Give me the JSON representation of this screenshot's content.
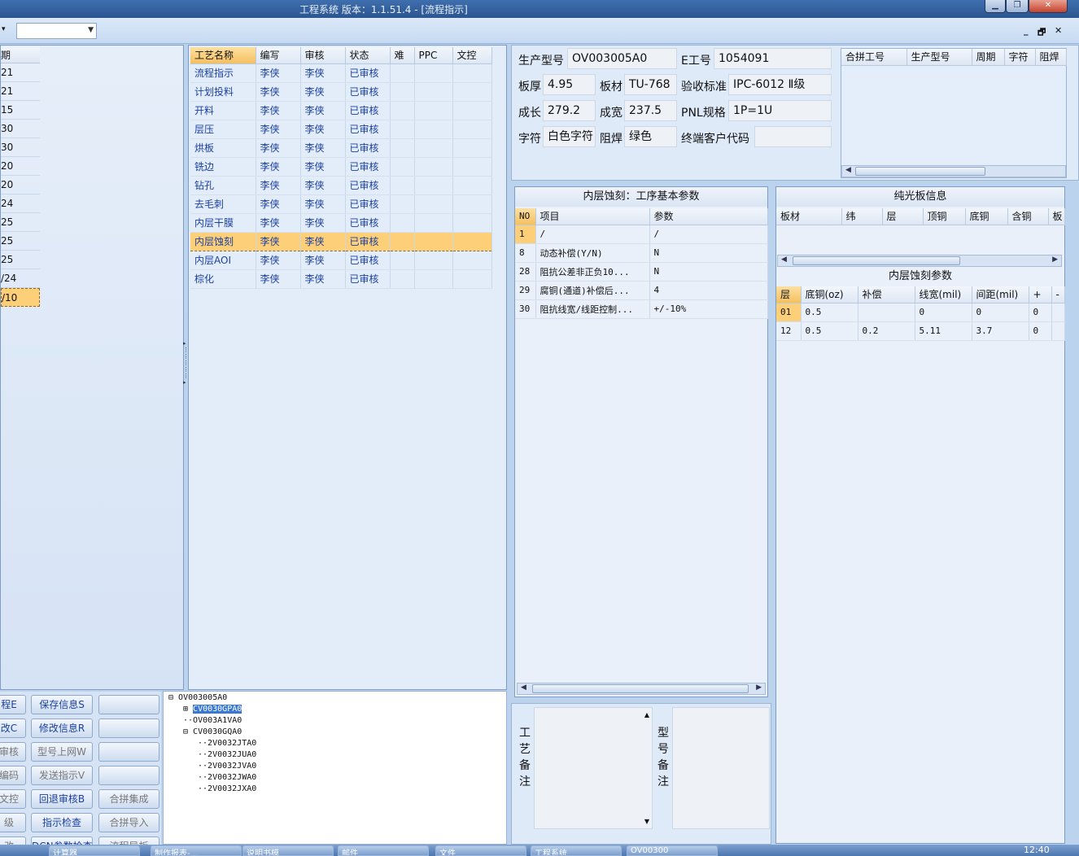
{
  "window": {
    "title": "工程系统    版本：1.1.51.4 - [流程指示]",
    "min": "▁",
    "restore": "❐",
    "close": "✕"
  },
  "toolbar": {
    "combo_value": "",
    "mdi_min": "_",
    "mdi_restore": "🗗",
    "mdi_close": "✕"
  },
  "left_list": {
    "header": "期",
    "items": [
      "21",
      "21",
      "15",
      "30",
      "30",
      "20",
      "20",
      "24",
      "25",
      "25",
      "25",
      "/24",
      "/10"
    ],
    "selected_index": 12
  },
  "process_grid": {
    "columns": [
      "工艺名称",
      "编写",
      "审核",
      "状态",
      "难",
      "PPC",
      "文控"
    ],
    "rows": [
      [
        "流程指示",
        "李侠",
        "李侠",
        "已审核"
      ],
      [
        "计划投料",
        "李侠",
        "李侠",
        "已审核"
      ],
      [
        "开料",
        "李侠",
        "李侠",
        "已审核"
      ],
      [
        "层压",
        "李侠",
        "李侠",
        "已审核"
      ],
      [
        "烘板",
        "李侠",
        "李侠",
        "已审核"
      ],
      [
        "铣边",
        "李侠",
        "李侠",
        "已审核"
      ],
      [
        "钻孔",
        "李侠",
        "李侠",
        "已审核"
      ],
      [
        "去毛刺",
        "李侠",
        "李侠",
        "已审核"
      ],
      [
        "内层干膜",
        "李侠",
        "李侠",
        "已审核"
      ],
      [
        "内层蚀刻",
        "李侠",
        "李侠",
        "已审核"
      ],
      [
        "内层AOI",
        "李侠",
        "李侠",
        "已审核"
      ],
      [
        "棕化",
        "李侠",
        "李侠",
        "已审核"
      ]
    ],
    "selected_index": 9
  },
  "info": {
    "model_label": "生产型号",
    "model_value": "OV003005A0",
    "eno_label": "E工号",
    "eno_value": "1054091",
    "thickness_label": "板厚",
    "thickness_value": "4.95",
    "material_label": "板材",
    "material_value": "TU-768",
    "standard_label": "验收标准",
    "standard_value": "IPC-6012 Ⅱ级",
    "length_label": "成长",
    "length_value": "279.2",
    "width_label": "成宽",
    "width_value": "237.5",
    "pnl_label": "PNL规格",
    "pnl_value": "1P=1U",
    "char_label": "字符",
    "char_value": "白色字符",
    "mask_label": "阻焊",
    "mask_value": "绿色",
    "customer_label": "终端客户代码",
    "customer_value": ""
  },
  "merge_grid": {
    "columns": [
      "合拼工号",
      "生产型号",
      "周期",
      "字符",
      "阻焊"
    ]
  },
  "params": {
    "title": "内层蚀刻：工序基本参数",
    "columns": [
      "NO",
      "项目",
      "参数"
    ],
    "rows": [
      [
        "1",
        "/",
        "/"
      ],
      [
        "8",
        "动态补偿(Y/N)",
        "N"
      ],
      [
        "28",
        "阻抗公差非正负10...",
        "N"
      ],
      [
        "29",
        "腐铜(通道)补偿后...",
        "4"
      ],
      [
        "30",
        "阻抗线宽/线距控制...",
        "+/-10%"
      ]
    ]
  },
  "light_board": {
    "title": "纯光板信息",
    "columns": [
      "板材",
      "纬",
      "层",
      "顶铜",
      "底铜",
      "含铜",
      "板"
    ]
  },
  "etch_params": {
    "title": "内层蚀刻参数",
    "columns": [
      "层",
      "底铜(oz)",
      "补偿",
      "线宽(mil)",
      "间距(mil)",
      "+",
      "-"
    ],
    "rows": [
      [
        "01",
        "0.5",
        "",
        "0",
        "0",
        "0"
      ],
      [
        "12",
        "0.5",
        "0.2",
        "5.11",
        "3.7",
        "0"
      ]
    ]
  },
  "buttons": {
    "col1": [
      "程E",
      "改C",
      "审核",
      "编码",
      "文控",
      "级",
      "改"
    ],
    "col2": [
      "保存信息S",
      "修改信息R",
      "型号上网W",
      "发送指示V",
      "回退审核B",
      "指示检查",
      "DCN参数检查"
    ],
    "col3": [
      "",
      "",
      "",
      "",
      "合拼集成",
      "合拼导入",
      "流程导板"
    ]
  },
  "tree": {
    "root": "OV003005A0",
    "nodes": [
      "CV0030GPA0",
      "OV003A1VA0",
      "CV0030GQA0",
      "2V0032JTA0",
      "2V0032JUA0",
      "2V0032JVA0",
      "2V0032JWA0",
      "2V0032JXA0"
    ]
  },
  "remarks": {
    "process": "工艺备注",
    "model": "型号备注"
  },
  "taskbar": {
    "items": [
      "计算器",
      "制作报表-...",
      "说明书模",
      "邮件",
      "文件",
      "工程系统",
      "OV00300"
    ],
    "time": "12:40"
  }
}
